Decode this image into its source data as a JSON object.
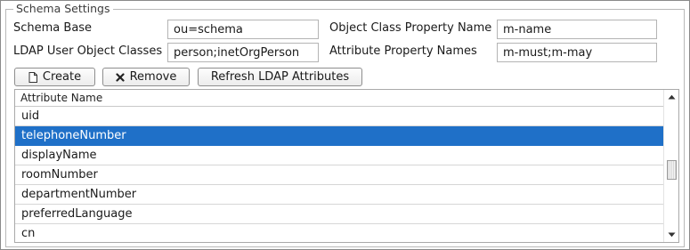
{
  "section": {
    "title": "Schema Settings"
  },
  "form": {
    "schema_base_label": "Schema Base",
    "schema_base_value": "ou=schema",
    "object_class_property_label": "Object Class Property Name",
    "object_class_property_value": "m-name",
    "ldap_user_object_classes_label": "LDAP User Object Classes",
    "ldap_user_object_classes_value": "person;inetOrgPerson",
    "attribute_property_names_label": "Attribute Property Names",
    "attribute_property_names_value": "m-must;m-may"
  },
  "toolbar": {
    "create_label": "Create",
    "create_icon": "document-icon",
    "remove_label": "Remove",
    "remove_icon": "x-icon",
    "refresh_label": "Refresh LDAP Attributes"
  },
  "grid": {
    "column_header": "Attribute Name",
    "rows": [
      "uid",
      "telephoneNumber",
      "displayName",
      "roomNumber",
      "departmentNumber",
      "preferredLanguage",
      "cn"
    ],
    "selected_row": "telephoneNumber",
    "selection_color": "#1f70c8"
  }
}
